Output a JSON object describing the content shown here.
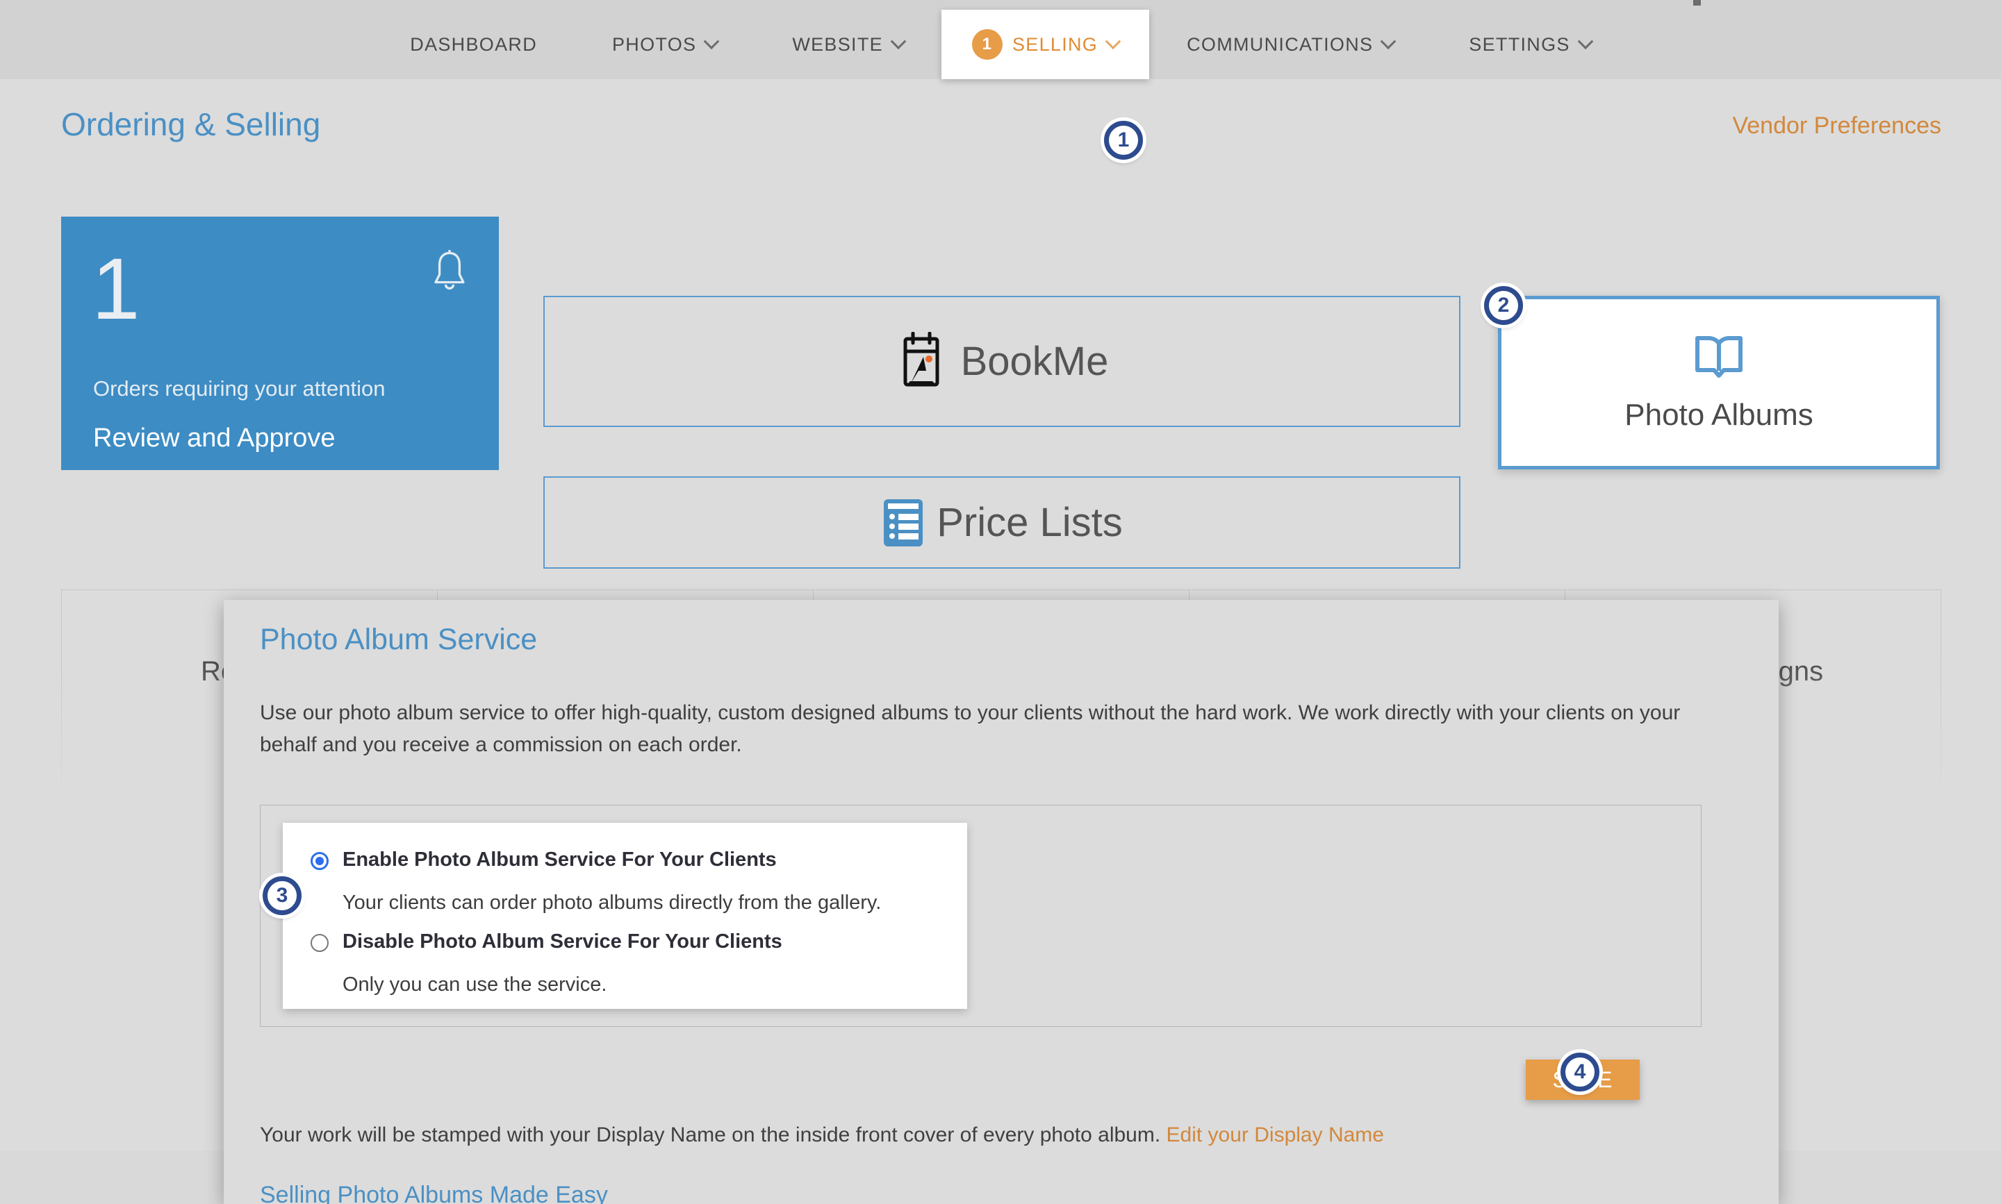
{
  "nav": {
    "items": [
      {
        "label": "DASHBOARD",
        "has_caret": false,
        "active": false,
        "badge": null
      },
      {
        "label": "PHOTOS",
        "has_caret": true,
        "active": false,
        "badge": null
      },
      {
        "label": "WEBSITE",
        "has_caret": true,
        "active": false,
        "badge": null
      },
      {
        "label": "SELLING",
        "has_caret": true,
        "active": true,
        "badge": "1"
      },
      {
        "label": "COMMUNICATIONS",
        "has_caret": true,
        "active": false,
        "badge": null
      },
      {
        "label": "SETTINGS",
        "has_caret": true,
        "active": false,
        "badge": null
      }
    ]
  },
  "page": {
    "title": "Ordering & Selling",
    "vendor_preferences": "Vendor Preferences"
  },
  "orders_card": {
    "count": "1",
    "subtitle": "Orders requiring your attention",
    "action": "Review and Approve",
    "icon": "bell-icon",
    "bg_color": "#3d8cc4"
  },
  "tiles": {
    "bookme": {
      "label": "BookMe",
      "icon": "bookme-calendar-icon"
    },
    "price_lists": {
      "label": "Price Lists",
      "icon": "price-list-icon"
    },
    "photo_albums": {
      "label": "Photo Albums",
      "icon": "open-book-icon",
      "selected": true
    }
  },
  "background_panels": [
    {
      "label": "Reports"
    },
    {
      "label": ""
    },
    {
      "label": ""
    },
    {
      "label": ""
    },
    {
      "label": "Campaigns"
    }
  ],
  "modal": {
    "title": "Photo Album Service",
    "description": "Use our photo album service to offer high-quality, custom designed albums to your clients without the hard work. We work directly with your clients on your behalf and you receive a commission on each order.",
    "options": [
      {
        "title": "Enable Photo Album Service For Your Clients",
        "note": "Your clients can order photo albums directly from the gallery.",
        "selected": true
      },
      {
        "title": "Disable Photo Album Service For Your Clients",
        "note": "Only you can use the service.",
        "selected": false
      }
    ],
    "save_label": "SAVE",
    "stamp_text": "Your work will be stamped with your Display Name on the inside front cover of every photo album.",
    "stamp_link": "Edit your Display Name",
    "made_easy_link": "Selling Photo Albums Made Easy"
  },
  "annotations": [
    {
      "id": "1",
      "target": "selling-nav-tab"
    },
    {
      "id": "2",
      "target": "photo-albums-tile"
    },
    {
      "id": "3",
      "target": "enable-photo-album-service-radio"
    },
    {
      "id": "4",
      "target": "save-button"
    }
  ],
  "colors": {
    "accent_orange": "#e79c47",
    "link_orange": "#d2883c",
    "accent_blue": "#4a90c4",
    "tile_blue": "#5b9bd0",
    "card_blue": "#3d8cc4",
    "radio_blue": "#2b6ef0",
    "annotation_navy": "#2d4b8e",
    "page_bg": "#dcdcdc"
  }
}
